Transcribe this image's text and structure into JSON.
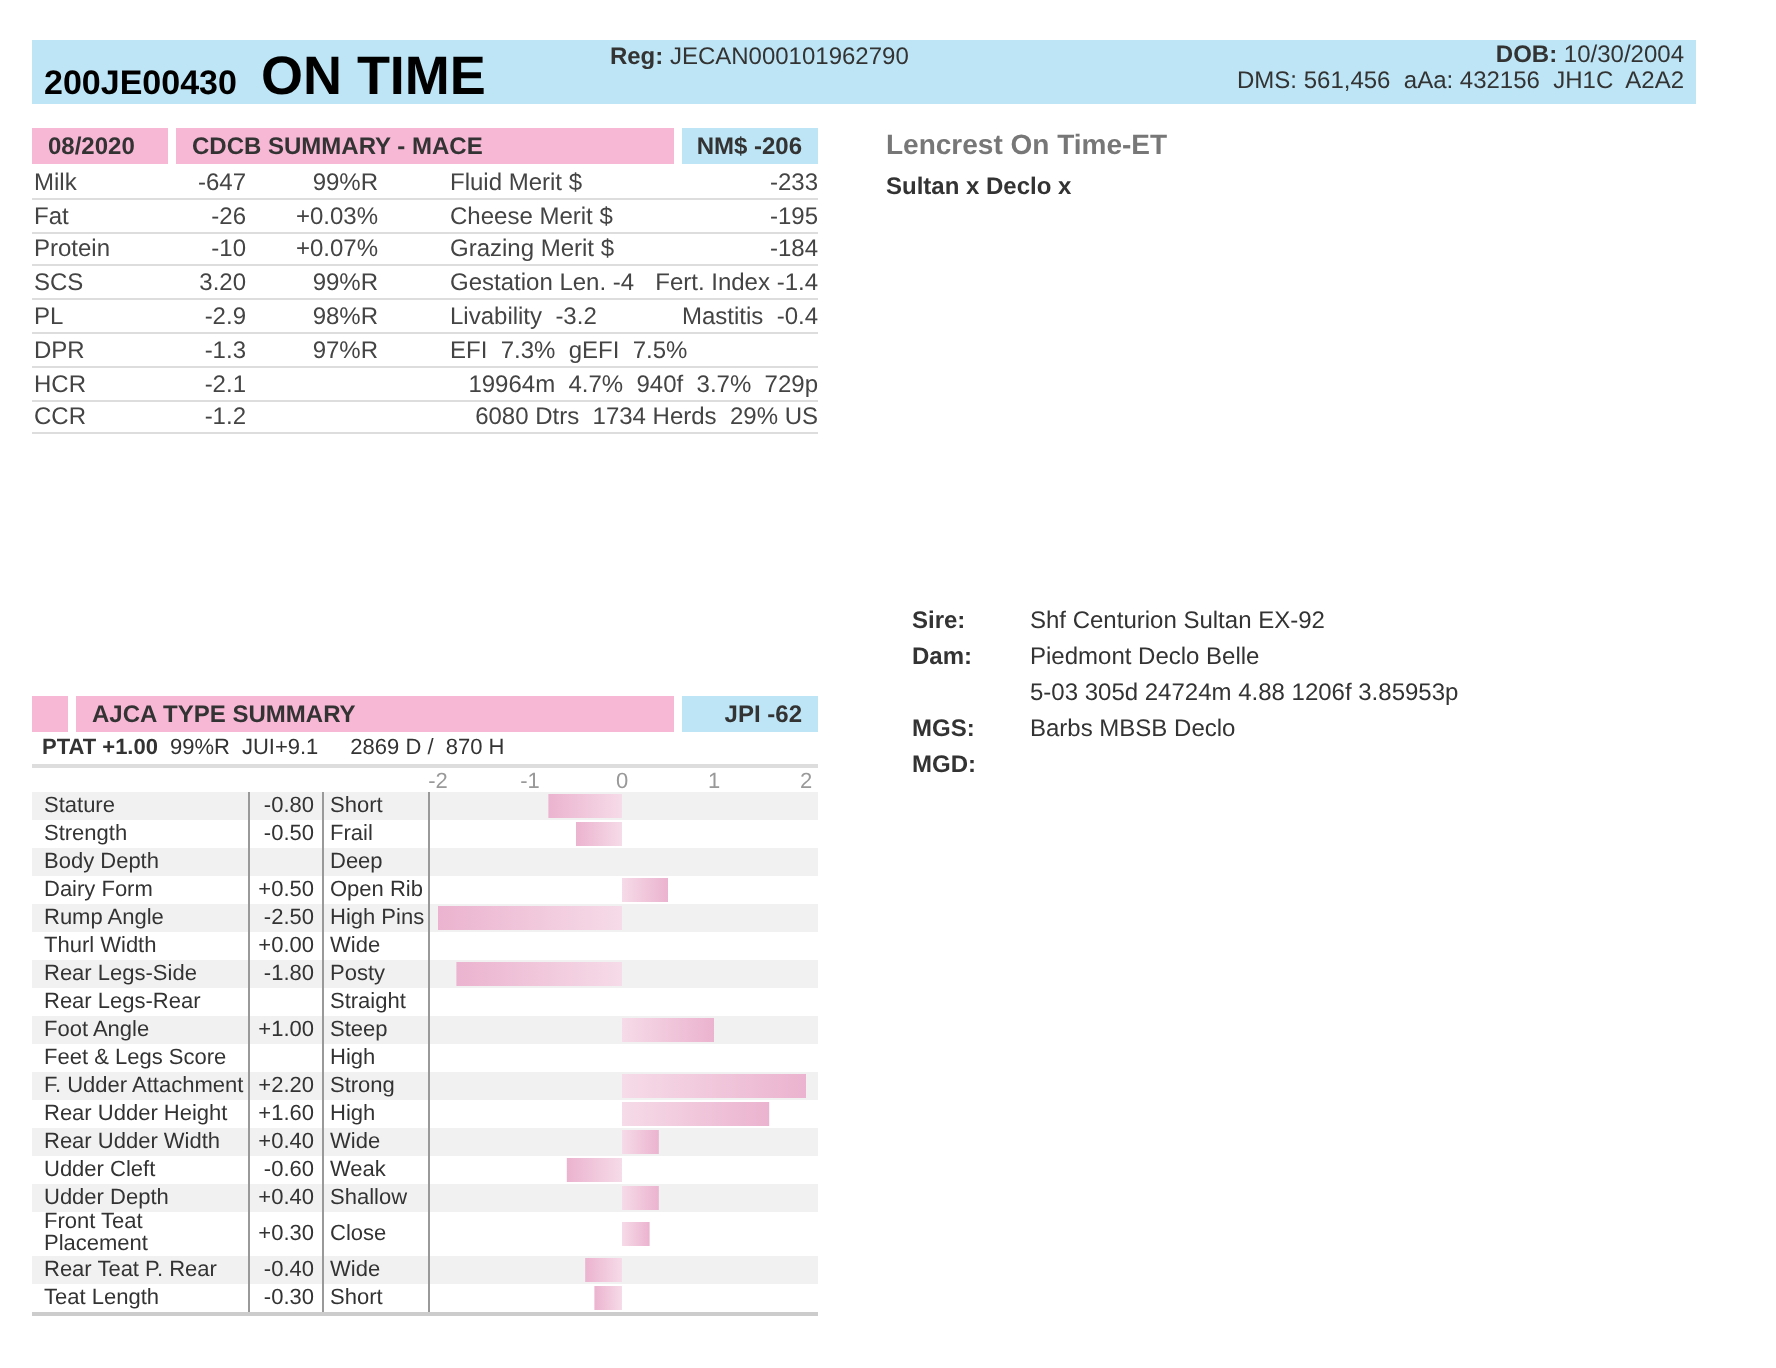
{
  "header": {
    "reg_number": "200JE00430",
    "name": "ON TIME",
    "reg_label": "Reg:",
    "reg_value": "JECAN000101962790",
    "dob_label": "DOB:",
    "dob_value": "10/30/2004",
    "codes": "DMS: 561,456  aAa: 432156  JH1C  A2A2"
  },
  "cdcb": {
    "date": "08/2020",
    "title": "CDCB SUMMARY - MACE",
    "index": "NM$ -206",
    "rows": [
      {
        "trait": "Milk",
        "value": "-647",
        "stat": "99%R",
        "info": "Fluid Merit $",
        "info_value": "-233"
      },
      {
        "trait": "Fat",
        "value": "-26",
        "stat": "+0.03%",
        "info": "Cheese Merit $",
        "info_value": "-195"
      },
      {
        "trait": "Protein",
        "value": "-10",
        "stat": "+0.07%",
        "info": "Grazing Merit $",
        "info_value": "-184"
      },
      {
        "trait": "SCS",
        "value": "3.20",
        "stat": "99%R",
        "info": "Gestation Len. -4",
        "info_value": "Fert. Index -1.4"
      },
      {
        "trait": "PL",
        "value": "-2.9",
        "stat": "98%R",
        "info": "Livability  -3.2",
        "info_value": "Mastitis  -0.4"
      },
      {
        "trait": "DPR",
        "value": "-1.3",
        "stat": "97%R",
        "info": "EFI  7.3%  gEFI  7.5%"
      },
      {
        "trait": "HCR",
        "value": "-2.1",
        "info_value": "19964m  4.7%  940f  3.7%  729p"
      },
      {
        "trait": "CCR",
        "value": "-1.2",
        "info_value": "6080 Dtrs  1734 Herds  29% US"
      }
    ]
  },
  "animal": {
    "full_name": "Lencrest On Time-ET",
    "pedigree_line": "Sultan x Declo x"
  },
  "pedigree": [
    {
      "label": "Sire:",
      "value": "Shf Centurion Sultan EX-92"
    },
    {
      "label": "Dam:",
      "value": "Piedmont Declo Belle",
      "detail": "5-03 305d 24724m 4.88 1206f 3.85953p"
    },
    {
      "label": "MGS:",
      "value": "Barbs MBSB Declo"
    },
    {
      "label": "MGD:"
    }
  ],
  "type_summary": {
    "title": "AJCA TYPE SUMMARY",
    "index": "JPI -62",
    "ptat": "PTAT +1.00",
    "reliability": "99%R",
    "jui": "JUI+9.1",
    "daughters": "2869 D /  870 H",
    "rows": [
      {
        "trait": "Stature",
        "value": "-0.80",
        "descriptor": "Short"
      },
      {
        "trait": "Strength",
        "value": "-0.50",
        "descriptor": "Frail"
      },
      {
        "trait": "Body Depth",
        "descriptor": "Deep"
      },
      {
        "trait": "Dairy Form",
        "value": "+0.50",
        "descriptor": "Open Rib"
      },
      {
        "trait": "Rump Angle",
        "value": "-2.50",
        "descriptor": "High Pins"
      },
      {
        "trait": "Thurl Width",
        "value": "+0.00",
        "descriptor": "Wide"
      },
      {
        "trait": "Rear Legs-Side",
        "value": "-1.80",
        "descriptor": "Posty"
      },
      {
        "trait": "Rear Legs-Rear",
        "descriptor": "Straight"
      },
      {
        "trait": "Foot Angle",
        "value": "+1.00",
        "descriptor": "Steep"
      },
      {
        "trait": "Feet & Legs Score",
        "descriptor": "High"
      },
      {
        "trait": "F. Udder Attachment",
        "value": "+2.20",
        "descriptor": "Strong"
      },
      {
        "trait": "Rear Udder Height",
        "value": "+1.60",
        "descriptor": "High"
      },
      {
        "trait": "Rear Udder Width",
        "value": "+0.40",
        "descriptor": "Wide"
      },
      {
        "trait": "Udder Cleft",
        "value": "-0.60",
        "descriptor": "Weak"
      },
      {
        "trait": "Udder Depth",
        "value": "+0.40",
        "descriptor": "Shallow"
      },
      {
        "trait": "Front Teat Placement",
        "value": "+0.30",
        "descriptor": "Close"
      },
      {
        "trait": "Rear Teat P. Rear",
        "value": "-0.40",
        "descriptor": "Wide"
      },
      {
        "trait": "Teat Length",
        "value": "-0.30",
        "descriptor": "Short"
      }
    ],
    "scale_labels": [
      "-2",
      "-1",
      "0",
      "1",
      "2"
    ]
  }
}
